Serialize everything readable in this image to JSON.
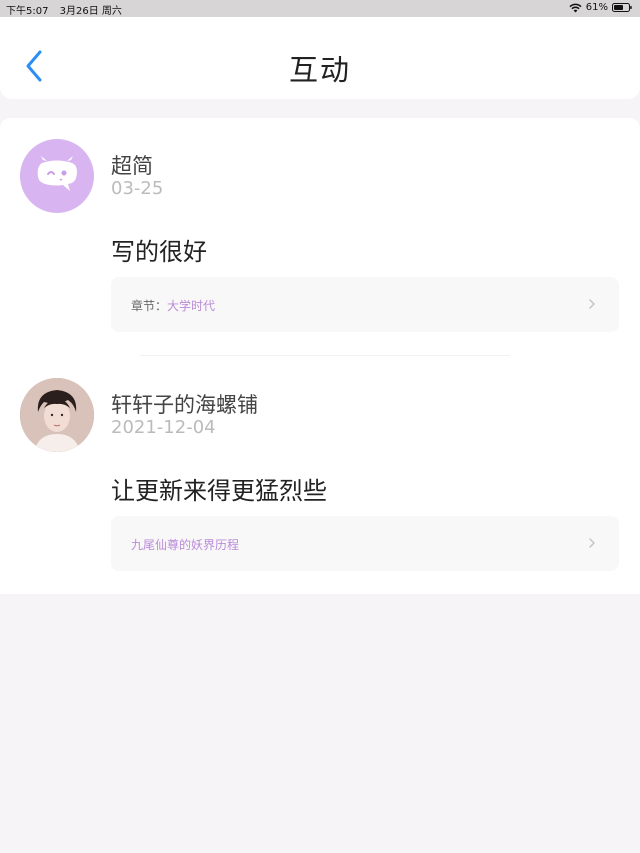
{
  "status_bar": {
    "time": "下午5:07",
    "date": "3月26日 周六",
    "battery": "61%",
    "icons": [
      "wifi-icon",
      "battery-icon"
    ]
  },
  "header": {
    "title": "互动",
    "back_icon": "chevron-left-icon",
    "accent_color": "#2c8ef5"
  },
  "interactions": [
    {
      "username": "超简",
      "date": "03-25",
      "comment": "写的很好",
      "reference_prefix": "章节：",
      "reference_title": "大学时代",
      "avatar": "chat-bubble-avatar"
    },
    {
      "username": "轩轩子的海螺铺",
      "date": "2021-12-04",
      "comment": "让更新来得更猛烈些",
      "reference_prefix": "",
      "reference_title": "九尾仙尊的妖界历程",
      "avatar": "user-photo-avatar"
    }
  ],
  "colors": {
    "link_purple": "#b98ad8",
    "avatar_purple": "#d8b5f1",
    "date_gray": "#bbbbbb"
  }
}
